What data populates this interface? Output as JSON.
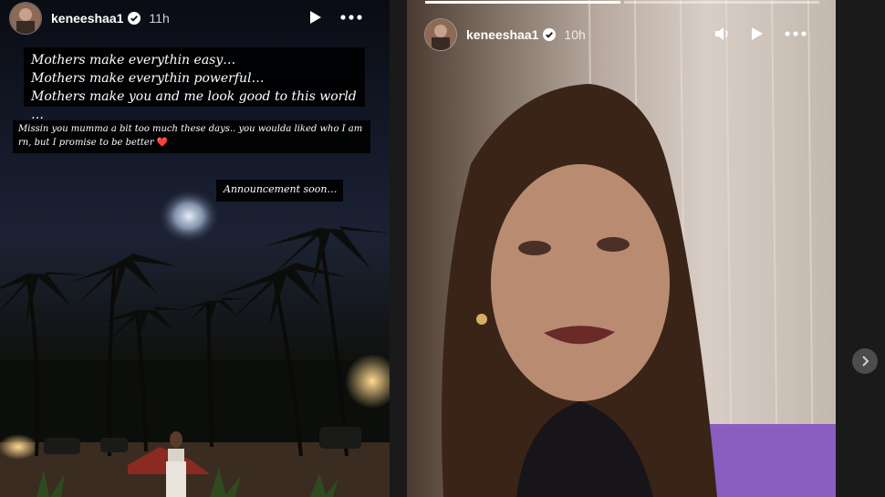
{
  "story_left": {
    "username": "keneeshaa1",
    "timestamp": "11h",
    "caption_lines": [
      "Mothers make everythin easy…",
      "Mothers make everythin powerful…",
      "Mothers make you and me look good to this world …"
    ],
    "caption_second": "Missin you mumma a bit too much these days.. you woulda liked who I am rn, but I promise to be better",
    "caption_second_emoji": "❤️",
    "caption_third": "Announcement soon…"
  },
  "story_right": {
    "username": "keneeshaa1",
    "timestamp": "10h",
    "progress_segments": [
      1.0,
      0.0
    ]
  },
  "icons": {
    "verified": "verified-badge-icon",
    "play": "play-icon",
    "more": "more-options-icon",
    "volume": "volume-icon",
    "next": "chevron-right-icon"
  }
}
